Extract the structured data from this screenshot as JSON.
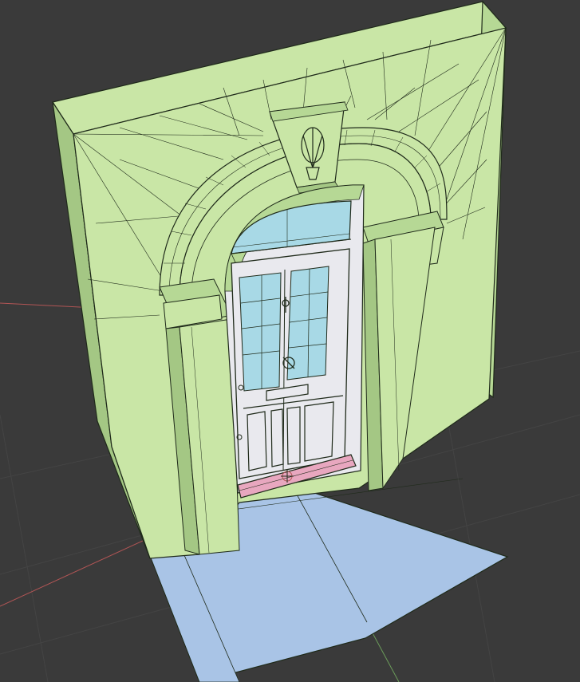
{
  "scene": {
    "kind": "3d-viewport-wireframe",
    "subject": "doorway-with-arch",
    "colors": {
      "background": "#3a3a3a",
      "grid": "#444444",
      "wall": "#c9e6a6",
      "wall_shade": "#b6d895",
      "wall_dark": "#a4c784",
      "floor": "#a9c4e6",
      "glass": "#a8d9e6",
      "door_frame": "#e9e9ee",
      "threshold": "#e8a7bf",
      "wire": "#1f2a1a",
      "axis_x": "#b25555",
      "axis_y": "#6b9c5a"
    }
  }
}
